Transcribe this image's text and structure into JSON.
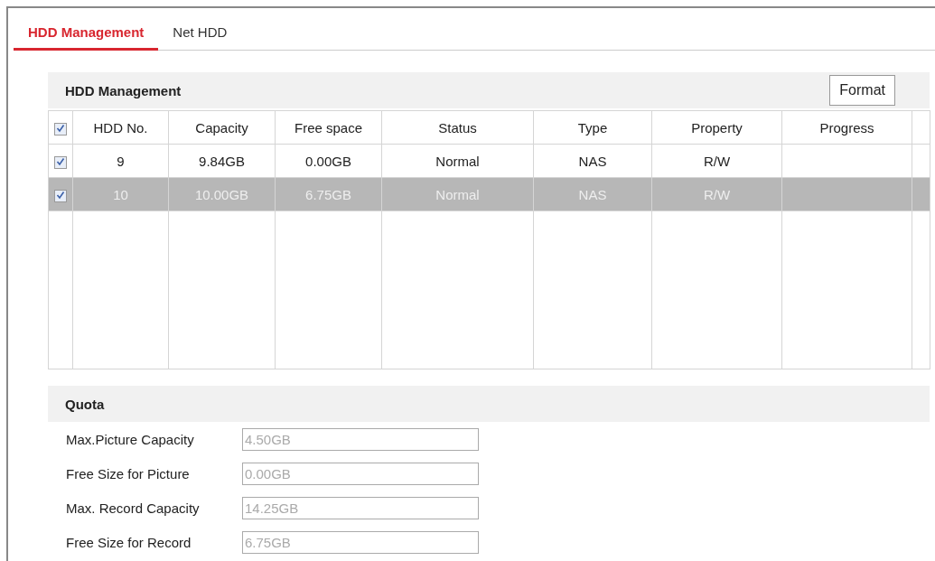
{
  "tabs": [
    {
      "label": "HDD Management",
      "selected": true
    },
    {
      "label": "Net HDD",
      "selected": false
    }
  ],
  "hdd_panel": {
    "title": "HDD Management",
    "format_button": "Format",
    "select_all_checked": true,
    "columns": [
      "HDD No.",
      "Capacity",
      "Free space",
      "Status",
      "Type",
      "Property",
      "Progress"
    ],
    "rows": [
      {
        "checked": true,
        "selected": false,
        "cells": [
          "9",
          "9.84GB",
          "0.00GB",
          "Normal",
          "NAS",
          "R/W",
          ""
        ]
      },
      {
        "checked": true,
        "selected": true,
        "cells": [
          "10",
          "10.00GB",
          "6.75GB",
          "Normal",
          "NAS",
          "R/W",
          ""
        ]
      }
    ]
  },
  "quota": {
    "title": "Quota",
    "fields": [
      {
        "label": "Max.Picture Capacity",
        "value": "4.50GB",
        "disabled": true
      },
      {
        "label": "Free Size for Picture",
        "value": "0.00GB",
        "disabled": true
      },
      {
        "label": "Max. Record Capacity",
        "value": "14.25GB",
        "disabled": true
      },
      {
        "label": "Free Size for Record",
        "value": "6.75GB",
        "disabled": true
      }
    ]
  }
}
